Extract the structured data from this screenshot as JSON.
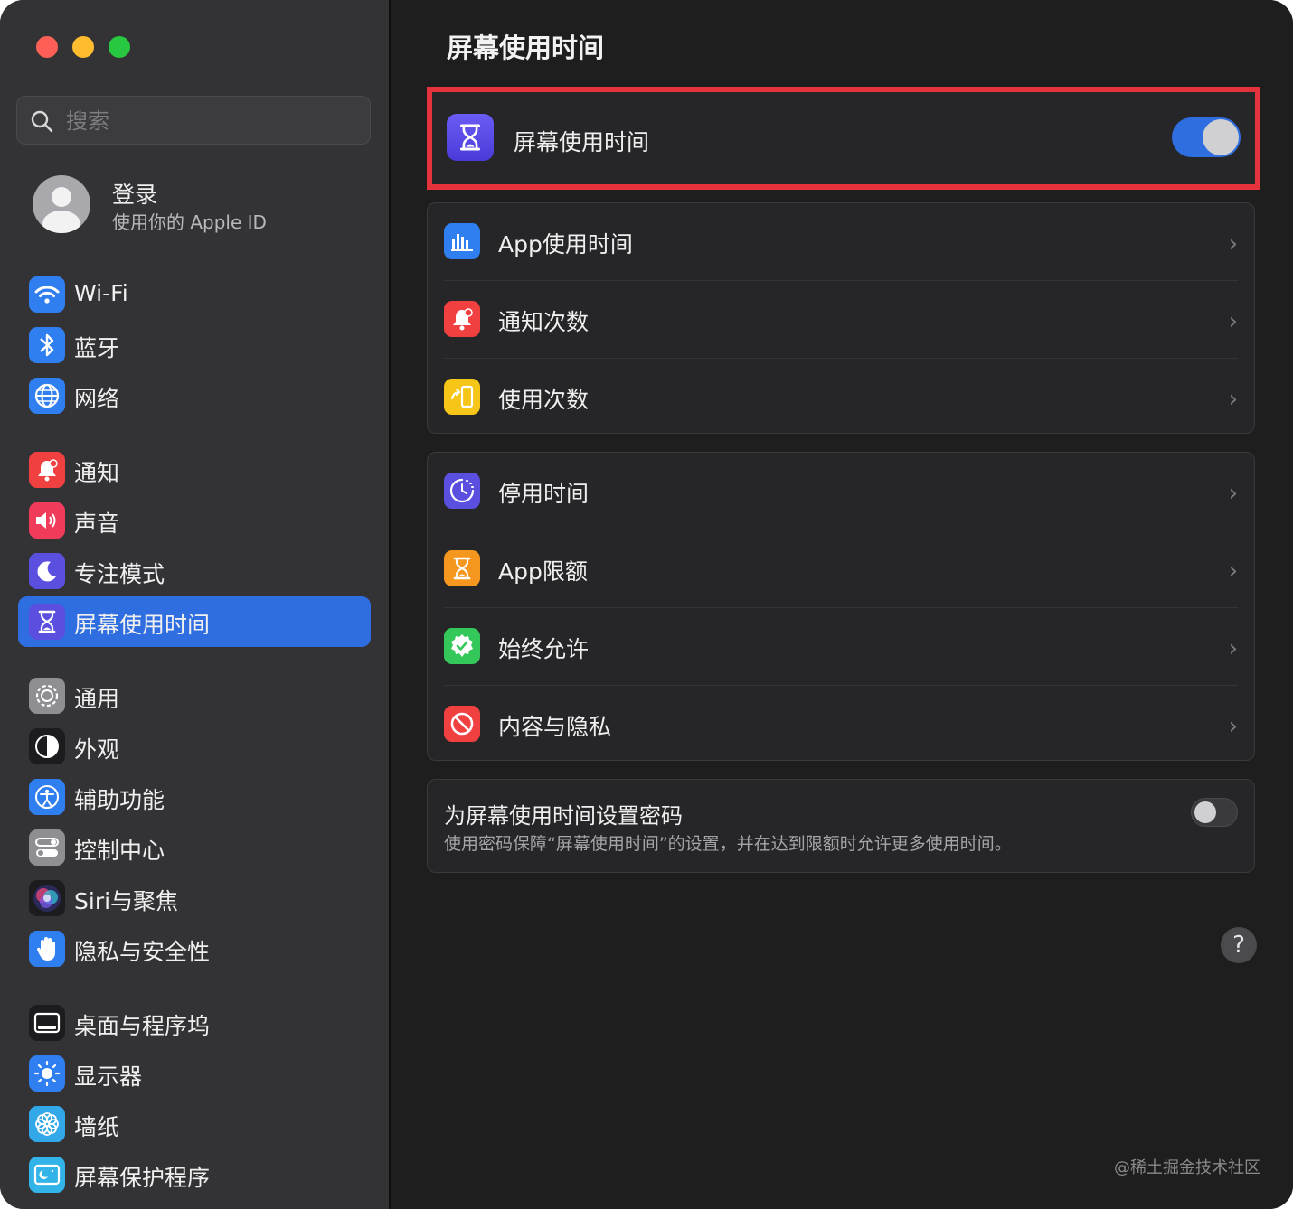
{
  "sidebar": {
    "search_placeholder": "搜索",
    "account": {
      "name": "登录",
      "subtitle": "使用你的 Apple ID"
    },
    "items": [
      {
        "label": "Wi-Fi",
        "icon": "wifi-icon",
        "color": "#2f7ff0"
      },
      {
        "label": "蓝牙",
        "icon": "bluetooth-icon",
        "color": "#2f7ff0"
      },
      {
        "label": "网络",
        "icon": "globe-icon",
        "color": "#2f7ff0"
      },
      {
        "label": "通知",
        "icon": "bell-icon",
        "color": "#f04040"
      },
      {
        "label": "声音",
        "icon": "speaker-icon",
        "color": "#f03c5a"
      },
      {
        "label": "专注模式",
        "icon": "moon-icon",
        "color": "#5b4fe0"
      },
      {
        "label": "屏幕使用时间",
        "icon": "hourglass-icon",
        "color": "#5b4fe0",
        "active": true
      },
      {
        "label": "通用",
        "icon": "gear-icon",
        "color": "#8e8e93"
      },
      {
        "label": "外观",
        "icon": "appearance-icon",
        "color": "#1c1c1e"
      },
      {
        "label": "辅助功能",
        "icon": "accessibility-icon",
        "color": "#2f7ff0"
      },
      {
        "label": "控制中心",
        "icon": "toggles-icon",
        "color": "#8e8e93"
      },
      {
        "label": "Siri与聚焦",
        "icon": "siri-icon",
        "color": "#1c1c1e"
      },
      {
        "label": "隐私与安全性",
        "icon": "hand-icon",
        "color": "#2f7ff0"
      },
      {
        "label": "桌面与程序坞",
        "icon": "dock-icon",
        "color": "#1c1c1e"
      },
      {
        "label": "显示器",
        "icon": "sun-icon",
        "color": "#2f7ff0"
      },
      {
        "label": "墙纸",
        "icon": "flower-icon",
        "color": "#33a8e8"
      },
      {
        "label": "屏幕保护程序",
        "icon": "screensaver-icon",
        "color": "#33b4e8"
      }
    ]
  },
  "main": {
    "title": "屏幕使用时间",
    "screen_time_toggle": {
      "label": "屏幕使用时间",
      "on": true
    },
    "group1": [
      {
        "label": "App使用时间",
        "icon": "chart-bars-icon",
        "color": "#2f7ff0"
      },
      {
        "label": "通知次数",
        "icon": "bell-icon",
        "color": "#f04040"
      },
      {
        "label": "使用次数",
        "icon": "pickup-icon",
        "color": "#f5c518"
      }
    ],
    "group2": [
      {
        "label": "停用时间",
        "icon": "downtime-icon",
        "color": "#5b4fe0"
      },
      {
        "label": "App限额",
        "icon": "hourglass-icon",
        "color": "#f5961e"
      },
      {
        "label": "始终允许",
        "icon": "checkmark-seal-icon",
        "color": "#34c759"
      },
      {
        "label": "内容与隐私",
        "icon": "no-entry-icon",
        "color": "#f04040"
      }
    ],
    "passcode": {
      "title": "为屏幕使用时间设置密码",
      "description": "使用密码保障“屏幕使用时间”的设置，并在达到限额时允许更多使用时间。",
      "on": false
    },
    "help": "?"
  },
  "watermark": "@稀土掘金技术社区"
}
